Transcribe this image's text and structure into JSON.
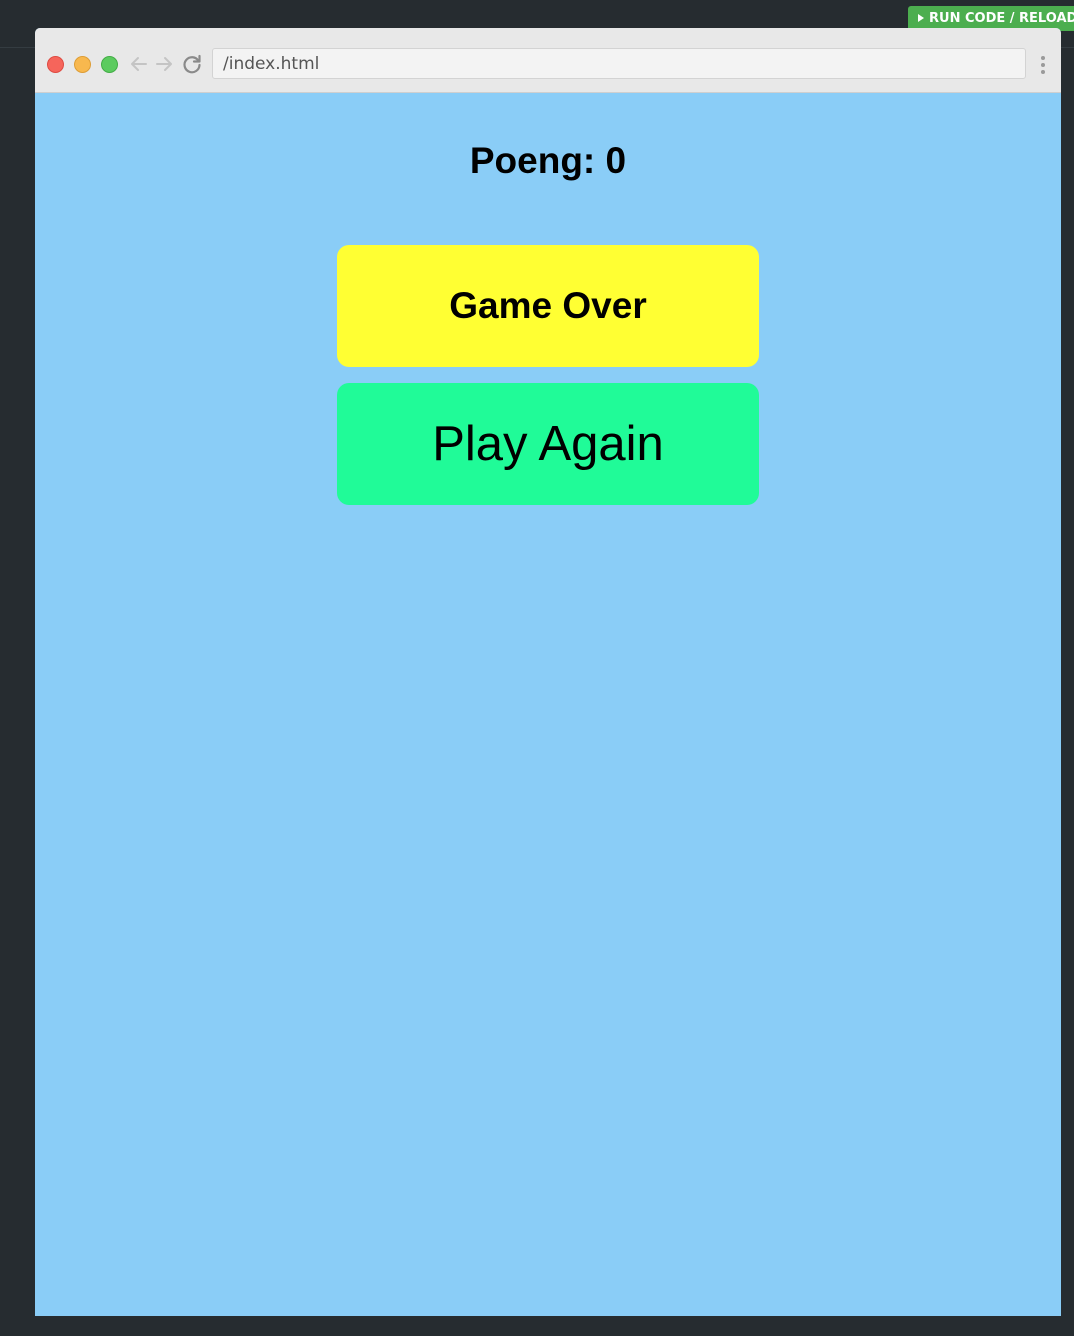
{
  "toolbar": {
    "run_label": "RUN CODE / RELOAD"
  },
  "browser": {
    "url": "/index.html",
    "icons": [
      "back-arrow-icon",
      "forward-arrow-icon",
      "reload-icon",
      "more-vert-icon"
    ]
  },
  "game": {
    "score_text": "Poeng: 0",
    "status_text": "Game Over",
    "play_again_label": "Play Again"
  },
  "colors": {
    "page_bg": "#8acdf7",
    "status_bg": "#ffff33",
    "play_again_bg": "#20fb98",
    "run_button_bg": "#4cae4f",
    "editor_bg": "#262c30"
  }
}
